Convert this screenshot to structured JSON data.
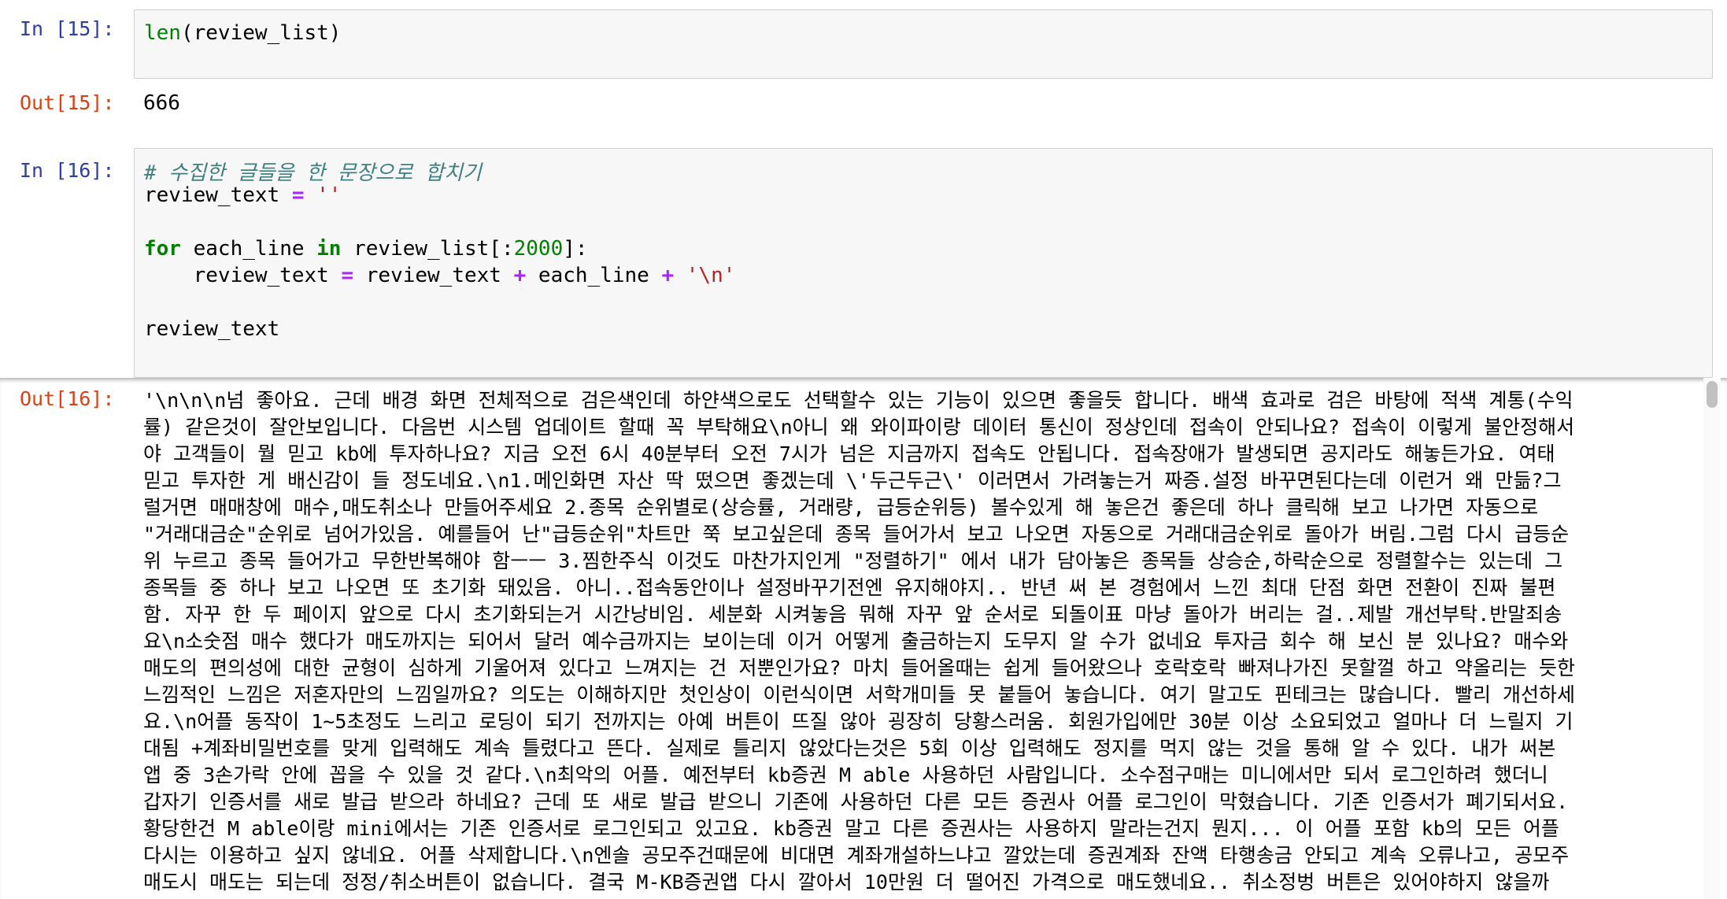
{
  "cells": [
    {
      "in_prompt": "In [15]:",
      "code_lines": [
        [
          {
            "t": "bi",
            "v": "len"
          },
          {
            "t": "p",
            "v": "(review_list)"
          }
        ]
      ],
      "out_prompt": "Out[15]:",
      "output": "666"
    },
    {
      "in_prompt": "In [16]:",
      "code_lines": [
        [
          {
            "t": "cm",
            "v": "# 수집한 글들을 한 문장으로 합치기"
          }
        ],
        [
          {
            "t": "p",
            "v": "review_text "
          },
          {
            "t": "op",
            "v": "="
          },
          {
            "t": "p",
            "v": " "
          },
          {
            "t": "str",
            "v": "''"
          }
        ],
        [],
        [
          {
            "t": "kw",
            "v": "for"
          },
          {
            "t": "p",
            "v": " each_line "
          },
          {
            "t": "kw",
            "v": "in"
          },
          {
            "t": "p",
            "v": " review_list[:"
          },
          {
            "t": "num",
            "v": "2000"
          },
          {
            "t": "p",
            "v": "]:"
          }
        ],
        [
          {
            "t": "p",
            "v": "    review_text "
          },
          {
            "t": "op",
            "v": "="
          },
          {
            "t": "p",
            "v": " review_text "
          },
          {
            "t": "op",
            "v": "+"
          },
          {
            "t": "p",
            "v": " each_line "
          },
          {
            "t": "op",
            "v": "+"
          },
          {
            "t": "p",
            "v": " "
          },
          {
            "t": "str",
            "v": "'\\n'"
          }
        ],
        [],
        [
          {
            "t": "p",
            "v": "review_text"
          }
        ]
      ],
      "out_prompt": "Out[16]:",
      "output_lines": [
        "'\\n\\n\\n넘 좋아요. 근데 배경 화면 전체적으로 검은색인데 하얀색으로도 선택할수 있는 기능이 있으면 좋을듯 합니다. 배색 효과로 검은 바탕에 적색 계통(수익",
        "률) 같은것이 잘안보입니다. 다음번 시스템 업데이트 할때 꼭 부탁해요\\n아니 왜 와이파이랑 데이터 통신이 정상인데 접속이 안되나요? 접속이 이렇게 불안정해서",
        "야 고객들이 뭘 믿고 kb에 투자하나요? 지금 오전 6시 40분부터 오전 7시가 넘은 지금까지 접속도 안됩니다. 접속장애가 발생되면 공지라도 해놓든가요. 여태",
        "믿고 투자한 게 배신감이 들 정도네요.\\n1.메인화면 자산 딱 떴으면 좋겠는데 \\'두근두근\\' 이러면서 가려놓는거 짜증.설정 바꾸면된다는데 이런거 왜 만듦?그",
        "럴거면 매매창에 매수,매도취소나 만들어주세요 2.종목 순위별로(상승률, 거래량, 급등순위등) 볼수있게 해 놓은건 좋은데 하나 클릭해 보고 나가면 자동으로",
        "\"거래대금순\"순위로 넘어가있음. 예를들어 난\"급등순위\"차트만 쭉 보고싶은데 종목 들어가서 보고 나오면 자동으로 거래대금순위로 돌아가 버림.그럼 다시 급등순",
        "위 누르고 종목 들어가고 무한반복해야 함ㅡㅡ 3.찜한주식 이것도 마찬가지인게 \"정렬하기\" 에서 내가 담아놓은 종목들 상승순,하락순으로 정렬할수는 있는데 그",
        "종목들 중 하나 보고 나오면 또 초기화 돼있음. 아니..접속동안이나 설정바꾸기전엔 유지해야지.. 반년 써 본 경험에서 느낀 최대 단점 화면 전환이 진짜 불편",
        "함. 자꾸 한 두 페이지 앞으로 다시 초기화되는거 시간낭비임. 세분화 시켜놓음 뭐해 자꾸 앞 순서로 되돌이표 마냥 돌아가 버리는 걸..제발 개선부탁.반말죄송",
        "요\\n소숫점 매수 했다가 매도까지는 되어서 달러 예수금까지는 보이는데 이거 어떻게 출금하는지 도무지 알 수가 없네요 투자금 회수 해 보신 분 있나요? 매수와",
        "매도의 편의성에 대한 균형이 심하게 기울어져 있다고 느껴지는 건 저뿐인가요? 마치 들어올때는 쉽게 들어왔으나 호락호락 빠져나가진 못할껄 하고 약올리는 듯한",
        "느낌적인 느낌은 저혼자만의 느낌일까요? 의도는 이해하지만 첫인상이 이런식이면 서학개미들 못 붙들어 놓습니다. 여기 말고도 핀테크는 많습니다. 빨리 개선하세",
        "요.\\n어플 동작이 1~5초정도 느리고 로딩이 되기 전까지는 아예 버튼이 뜨질 않아 굉장히 당황스러움. 회원가입에만 30분 이상 소요되었고 얼마나 더 느릴지 기",
        "대됨 +계좌비밀번호를 맞게 입력해도 계속 틀렸다고 뜬다. 실제로 틀리지 않았다는것은 5회 이상 입력해도 정지를 먹지 않는 것을 통해 알 수 있다. 내가 써본",
        "앱 중 3손가락 안에 꼽을 수 있을 것 같다.\\n최악의 어플. 예전부터 kb증권 M able 사용하던 사람입니다. 소수점구매는 미니에서만 되서 로그인하려 했더니",
        "갑자기 인증서를 새로 발급 받으라 하네요? 근데 또 새로 발급 받으니 기존에 사용하던 다른 모든 증권사 어플 로그인이 막혔습니다. 기존 인증서가 폐기되서요.",
        "황당한건 M able이랑 mini에서는 기존 인증서로 로그인되고 있고요. kb증권 말고 다른 증권사는 사용하지 말라는건지 뭔지... 이 어플 포함 kb의 모든 어플",
        "다시는 이용하고 싶지 않네요. 어플 삭제합니다.\\n엔솔 공모주건때문에 비대면 계좌개설하느냐고 깔았는데 증권계좌 잔액 타행송금 안되고 계속 오류나고, 공모주",
        "매도시 매도는 되는데 정정/취소버튼이 없습니다. 결국 M-KB증권앱 다시 깔아서 10만원 더 떨어진 가격으로 매도했네요.. 취소정벙 버튼은 있어야하지 않을까"
      ]
    }
  ]
}
